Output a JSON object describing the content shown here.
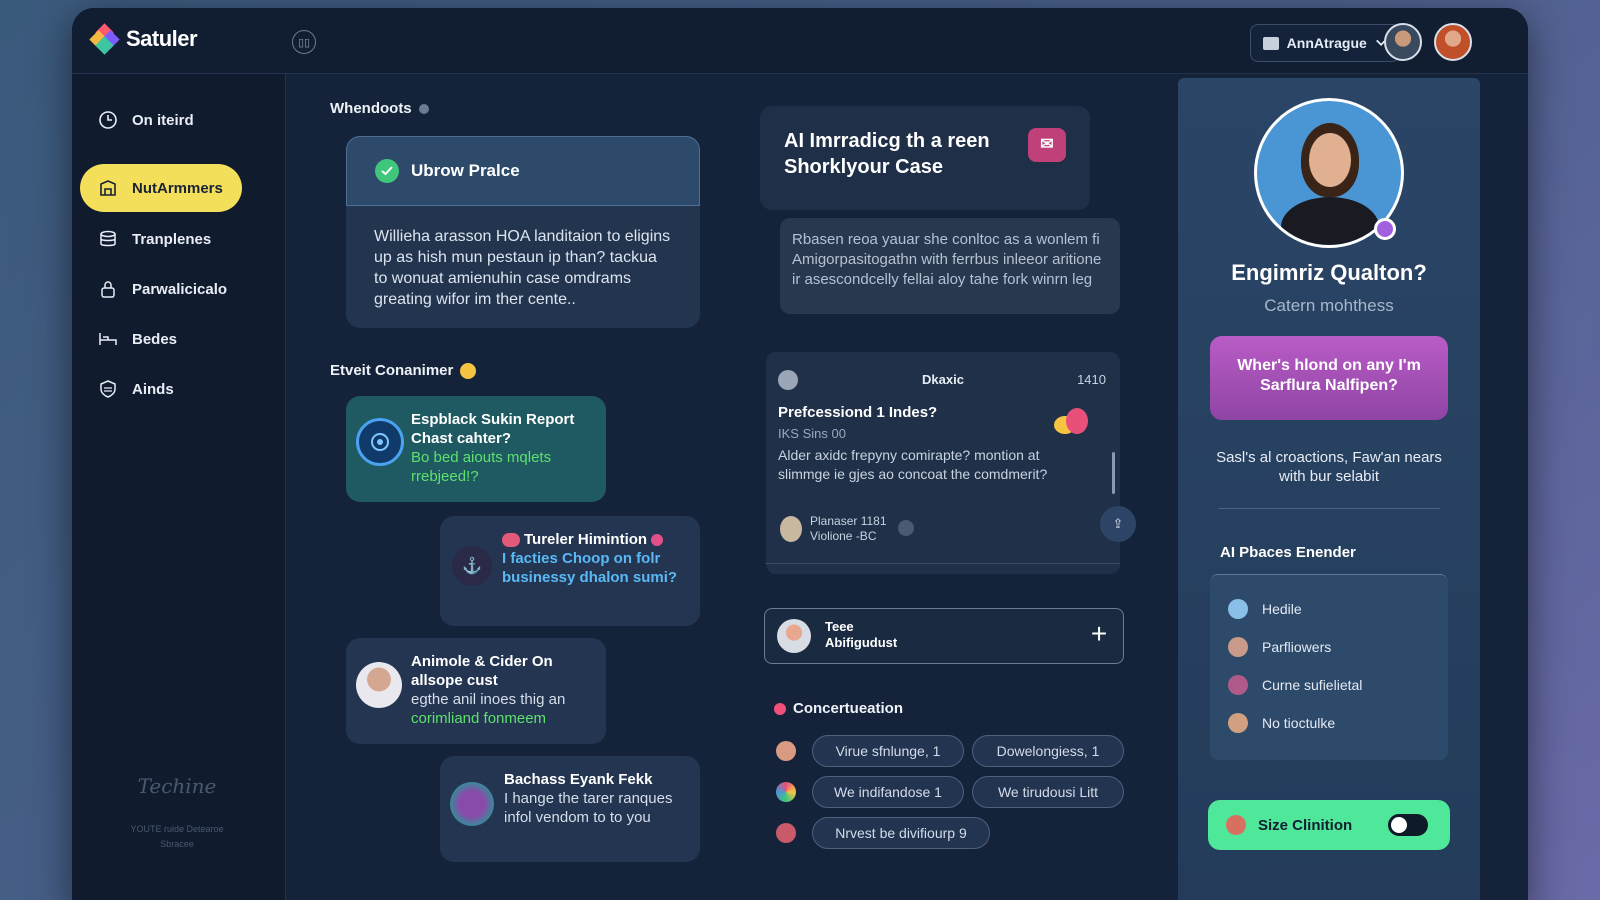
{
  "app": {
    "name": "Satuler"
  },
  "header": {
    "account_label": "AnnAtrague"
  },
  "sidebar": {
    "items": [
      {
        "label": "On iteird",
        "icon": "clock-icon"
      },
      {
        "label": "NutArmmers",
        "icon": "building-icon",
        "active": true
      },
      {
        "label": "Tranplenes",
        "icon": "stack-icon"
      },
      {
        "label": "Parwalicicalo",
        "icon": "lock-icon"
      },
      {
        "label": "Bedes",
        "icon": "bed-icon"
      },
      {
        "label": "Ainds",
        "icon": "shield-icon"
      }
    ],
    "watermark": {
      "title": "Techine",
      "sub1": "YOUTE ruide Detearoe",
      "sub2": "Sbracee"
    }
  },
  "feed": {
    "section1": "Whendoots",
    "featured": {
      "title": "Ubrow Pralce",
      "body": "Willieha arasson HOA landitaion to eligins up as hish mun pestaun ip than? tackua to wonuat amienuhin case omdrams greating wifor im ther cente.."
    },
    "section2": "Etveit Conanimer",
    "messages": [
      {
        "title": "Espblack Sukin Report Chast cahter?",
        "accent": "Bo bed aiouts mqlets rrebjeed!?"
      },
      {
        "title": "Tureler Himintion",
        "accent": "I facties Choop on folr businessy dhalon sumi?"
      },
      {
        "title": "Animole & Cider On allsope cust",
        "text": "egthe anil inoes thig an",
        "accent": "corimliand fonmeem"
      },
      {
        "title": "Bachass Eyank Fekk",
        "text": "I hange the tarer ranques infol vendom to to you"
      }
    ]
  },
  "center": {
    "ai_title": "AI Imrradicg th a reen Shorklyour Case",
    "ai_text": "Rbasen reoa yauar she conltoc as a wonlem fi Amigorpasitogathn with ferrbus inleeor aritione ir asescondcelly fellai aloy tahe fork winrn leg",
    "detail": {
      "header_label": "Dkaxic",
      "header_value": "1410",
      "title": "Prefcessiond 1 Indes?",
      "subtitle": "IKS Sins 00",
      "body": "Alder axidc frepyny comirapte? montion at slimmge ie gjes ao concoat the comdmerit?",
      "foot1": "Planaser 1181",
      "foot2": "Violione -BC"
    },
    "add_row": {
      "line1": "Teee",
      "line2": "Abifigudust"
    },
    "section3": "Concertueation",
    "chips": [
      [
        "Virue sfnlunge, 1",
        "Dowelongiess, 1"
      ],
      [
        "We indifandose 1",
        "We tirudousi Litt"
      ],
      [
        "Nrvest be divifiourp 9"
      ]
    ]
  },
  "profile": {
    "name": "Engimriz Qualton?",
    "subtitle": "Catern mohthess",
    "cta": "Wher's hlond on any I'm Sarflura Nalfipen?",
    "note": "Sasl's al croactions, Faw'an nears with bur selabit",
    "list_title": "AI Pbaces Enender",
    "list": [
      "Hedile",
      "Parfliowers",
      "Curne sufielietal",
      "No tioctulke"
    ],
    "toggle_label": "Size Clinition",
    "toggle_on": false
  }
}
